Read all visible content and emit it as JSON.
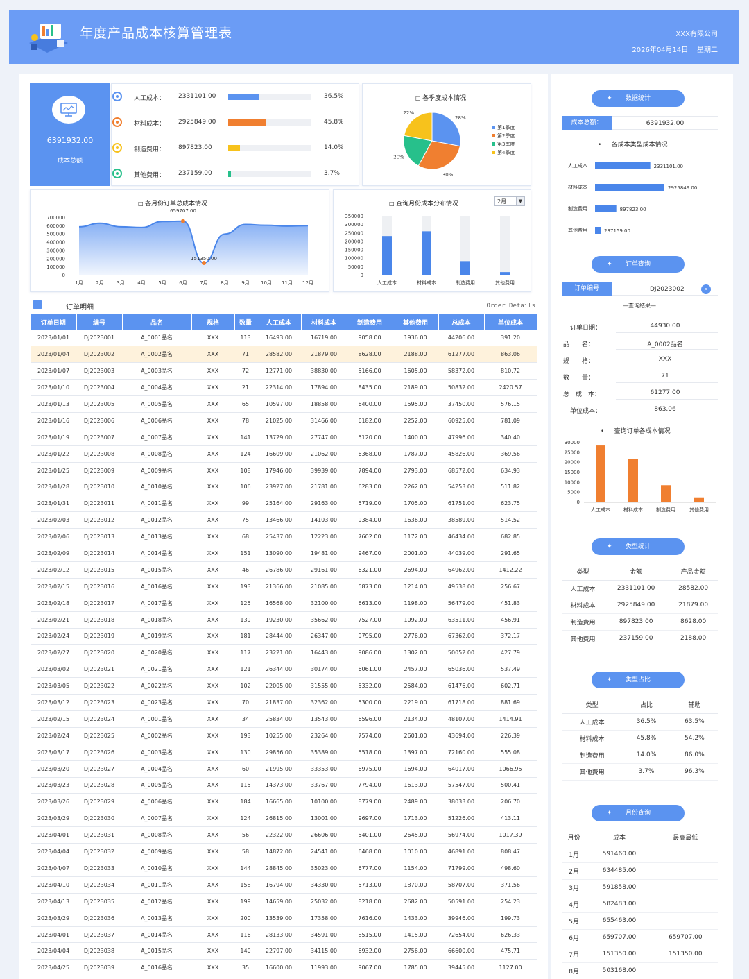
{
  "header": {
    "title": "年度产品成本核算管理表",
    "company": "XXX有限公司",
    "date": "2026年04月14日",
    "weekday": "星期二"
  },
  "summary": {
    "total_value": "6391932.00",
    "total_label": "成本总额",
    "items": [
      {
        "label": "人工成本：",
        "value": "2331101.00",
        "pct": "36.5%",
        "fraction": 0.365,
        "color": "#5b93f0",
        "icon_color": "#5b93f0"
      },
      {
        "label": "材料成本：",
        "value": "2925849.00",
        "pct": "45.8%",
        "fraction": 0.458,
        "color": "#f07f30",
        "icon_color": "#f07f30"
      },
      {
        "label": "制造费用：",
        "value": "897823.00",
        "pct": "14.0%",
        "fraction": 0.14,
        "color": "#f7c21c",
        "icon_color": "#f7c21c"
      },
      {
        "label": "其他费用：",
        "value": "237159.00",
        "pct": "3.7%",
        "fraction": 0.037,
        "color": "#27c08b",
        "icon_color": "#27c08b"
      }
    ]
  },
  "quarter_chart": {
    "title": "各季度成本情况"
  },
  "monthly_chart": {
    "title": "各月份订单总成本情况",
    "max_label": "659707.00",
    "min_label": "151350.00"
  },
  "month_query_chart": {
    "title": "查询月份成本分布情况",
    "selected_month": "2月"
  },
  "orders": {
    "icon": "document-icon",
    "title": "订单明细",
    "subtitle": "Order Details",
    "headers": [
      "订单日期",
      "编号",
      "品名",
      "规格",
      "数量",
      "人工成本",
      "材料成本",
      "制造费用",
      "其他费用",
      "总成本",
      "单位成本"
    ],
    "highlight_row": 1,
    "rows": [
      [
        "2023/01/01",
        "DJ2023001",
        "A_0001品名",
        "XXX",
        "113",
        "16493.00",
        "16719.00",
        "9058.00",
        "1936.00",
        "44206.00",
        "391.20"
      ],
      [
        "2023/01/04",
        "DJ2023002",
        "A_0002品名",
        "XXX",
        "71",
        "28582.00",
        "21879.00",
        "8628.00",
        "2188.00",
        "61277.00",
        "863.06"
      ],
      [
        "2023/01/07",
        "DJ2023003",
        "A_0003品名",
        "XXX",
        "72",
        "12771.00",
        "38830.00",
        "5166.00",
        "1605.00",
        "58372.00",
        "810.72"
      ],
      [
        "2023/01/10",
        "DJ2023004",
        "A_0004品名",
        "XXX",
        "21",
        "22314.00",
        "17894.00",
        "8435.00",
        "2189.00",
        "50832.00",
        "2420.57"
      ],
      [
        "2023/01/13",
        "DJ2023005",
        "A_0005品名",
        "XXX",
        "65",
        "10597.00",
        "18858.00",
        "6400.00",
        "1595.00",
        "37450.00",
        "576.15"
      ],
      [
        "2023/01/16",
        "DJ2023006",
        "A_0006品名",
        "XXX",
        "78",
        "21025.00",
        "31466.00",
        "6182.00",
        "2252.00",
        "60925.00",
        "781.09"
      ],
      [
        "2023/01/19",
        "DJ2023007",
        "A_0007品名",
        "XXX",
        "141",
        "13729.00",
        "27747.00",
        "5120.00",
        "1400.00",
        "47996.00",
        "340.40"
      ],
      [
        "2023/01/22",
        "DJ2023008",
        "A_0008品名",
        "XXX",
        "124",
        "16609.00",
        "21062.00",
        "6368.00",
        "1787.00",
        "45826.00",
        "369.56"
      ],
      [
        "2023/01/25",
        "DJ2023009",
        "A_0009品名",
        "XXX",
        "108",
        "17946.00",
        "39939.00",
        "7894.00",
        "2793.00",
        "68572.00",
        "634.93"
      ],
      [
        "2023/01/28",
        "DJ2023010",
        "A_0010品名",
        "XXX",
        "106",
        "23927.00",
        "21781.00",
        "6283.00",
        "2262.00",
        "54253.00",
        "511.82"
      ],
      [
        "2023/01/31",
        "DJ2023011",
        "A_0011品名",
        "XXX",
        "99",
        "25164.00",
        "29163.00",
        "5719.00",
        "1705.00",
        "61751.00",
        "623.75"
      ],
      [
        "2023/02/03",
        "DJ2023012",
        "A_0012品名",
        "XXX",
        "75",
        "13466.00",
        "14103.00",
        "9384.00",
        "1636.00",
        "38589.00",
        "514.52"
      ],
      [
        "2023/02/06",
        "DJ2023013",
        "A_0013品名",
        "XXX",
        "68",
        "25437.00",
        "12223.00",
        "7602.00",
        "1172.00",
        "46434.00",
        "682.85"
      ],
      [
        "2023/02/09",
        "DJ2023014",
        "A_0014品名",
        "XXX",
        "151",
        "13090.00",
        "19481.00",
        "9467.00",
        "2001.00",
        "44039.00",
        "291.65"
      ],
      [
        "2023/02/12",
        "DJ2023015",
        "A_0015品名",
        "XXX",
        "46",
        "26786.00",
        "29161.00",
        "6321.00",
        "2694.00",
        "64962.00",
        "1412.22"
      ],
      [
        "2023/02/15",
        "DJ2023016",
        "A_0016品名",
        "XXX",
        "193",
        "21366.00",
        "21085.00",
        "5873.00",
        "1214.00",
        "49538.00",
        "256.67"
      ],
      [
        "2023/02/18",
        "DJ2023017",
        "A_0017品名",
        "XXX",
        "125",
        "16568.00",
        "32100.00",
        "6613.00",
        "1198.00",
        "56479.00",
        "451.83"
      ],
      [
        "2023/02/21",
        "DJ2023018",
        "A_0018品名",
        "XXX",
        "139",
        "19230.00",
        "35662.00",
        "7527.00",
        "1092.00",
        "63511.00",
        "456.91"
      ],
      [
        "2023/02/24",
        "DJ2023019",
        "A_0019品名",
        "XXX",
        "181",
        "28444.00",
        "26347.00",
        "9795.00",
        "2776.00",
        "67362.00",
        "372.17"
      ],
      [
        "2023/02/27",
        "DJ2023020",
        "A_0020品名",
        "XXX",
        "117",
        "23221.00",
        "16443.00",
        "9086.00",
        "1302.00",
        "50052.00",
        "427.79"
      ],
      [
        "2023/03/02",
        "DJ2023021",
        "A_0021品名",
        "XXX",
        "121",
        "26344.00",
        "30174.00",
        "6061.00",
        "2457.00",
        "65036.00",
        "537.49"
      ],
      [
        "2023/03/05",
        "DJ2023022",
        "A_0022品名",
        "XXX",
        "102",
        "22005.00",
        "31555.00",
        "5332.00",
        "2584.00",
        "61476.00",
        "602.71"
      ],
      [
        "2023/03/12",
        "DJ2023023",
        "A_0023品名",
        "XXX",
        "70",
        "21837.00",
        "32362.00",
        "5300.00",
        "2219.00",
        "61718.00",
        "881.69"
      ],
      [
        "2023/02/15",
        "DJ2023024",
        "A_0001品名",
        "XXX",
        "34",
        "25834.00",
        "13543.00",
        "6596.00",
        "2134.00",
        "48107.00",
        "1414.91"
      ],
      [
        "2023/02/24",
        "DJ2023025",
        "A_0002品名",
        "XXX",
        "193",
        "10255.00",
        "23264.00",
        "7574.00",
        "2601.00",
        "43694.00",
        "226.39"
      ],
      [
        "2023/03/17",
        "DJ2023026",
        "A_0003品名",
        "XXX",
        "130",
        "29856.00",
        "35389.00",
        "5518.00",
        "1397.00",
        "72160.00",
        "555.08"
      ],
      [
        "2023/03/20",
        "DJ2023027",
        "A_0004品名",
        "XXX",
        "60",
        "21995.00",
        "33353.00",
        "6975.00",
        "1694.00",
        "64017.00",
        "1066.95"
      ],
      [
        "2023/03/23",
        "DJ2023028",
        "A_0005品名",
        "XXX",
        "115",
        "14373.00",
        "33767.00",
        "7794.00",
        "1613.00",
        "57547.00",
        "500.41"
      ],
      [
        "2023/03/26",
        "DJ2023029",
        "A_0006品名",
        "XXX",
        "184",
        "16665.00",
        "10100.00",
        "8779.00",
        "2489.00",
        "38033.00",
        "206.70"
      ],
      [
        "2023/03/29",
        "DJ2023030",
        "A_0007品名",
        "XXX",
        "124",
        "26815.00",
        "13001.00",
        "9697.00",
        "1713.00",
        "51226.00",
        "413.11"
      ],
      [
        "2023/04/01",
        "DJ2023031",
        "A_0008品名",
        "XXX",
        "56",
        "22322.00",
        "26606.00",
        "5401.00",
        "2645.00",
        "56974.00",
        "1017.39"
      ],
      [
        "2023/04/04",
        "DJ2023032",
        "A_0009品名",
        "XXX",
        "58",
        "14872.00",
        "24541.00",
        "6468.00",
        "1010.00",
        "46891.00",
        "808.47"
      ],
      [
        "2023/04/07",
        "DJ2023033",
        "A_0010品名",
        "XXX",
        "144",
        "28845.00",
        "35023.00",
        "6777.00",
        "1154.00",
        "71799.00",
        "498.60"
      ],
      [
        "2023/04/10",
        "DJ2023034",
        "A_0011品名",
        "XXX",
        "158",
        "16794.00",
        "34330.00",
        "5713.00",
        "1870.00",
        "58707.00",
        "371.56"
      ],
      [
        "2023/04/13",
        "DJ2023035",
        "A_0012品名",
        "XXX",
        "199",
        "14659.00",
        "25032.00",
        "8218.00",
        "2682.00",
        "50591.00",
        "254.23"
      ],
      [
        "2023/03/29",
        "DJ2023036",
        "A_0013品名",
        "XXX",
        "200",
        "13539.00",
        "17358.00",
        "7616.00",
        "1433.00",
        "39946.00",
        "199.73"
      ],
      [
        "2023/04/01",
        "DJ2023037",
        "A_0014品名",
        "XXX",
        "116",
        "28133.00",
        "34591.00",
        "8515.00",
        "1415.00",
        "72654.00",
        "626.33"
      ],
      [
        "2023/04/04",
        "DJ2023038",
        "A_0015品名",
        "XXX",
        "140",
        "22797.00",
        "34115.00",
        "6932.00",
        "2756.00",
        "66600.00",
        "475.71"
      ],
      [
        "2023/04/25",
        "DJ2023039",
        "A_0016品名",
        "XXX",
        "35",
        "16600.00",
        "11993.00",
        "9067.00",
        "1785.00",
        "39445.00",
        "1127.00"
      ]
    ]
  },
  "side": {
    "stats_btn": "数据统计",
    "total_label": "成本总额：",
    "total_value": "6391932.00",
    "type_chart_title": "各成本类型成本情况",
    "order_btn": "订单查询",
    "order_no_label": "订单编号",
    "order_no_value": "DJ2023002",
    "result_label": "—查询结果—",
    "details": [
      {
        "label": "订单日期：",
        "value": "44930.00"
      },
      {
        "label": "品　　名：",
        "value": "A_0002品名"
      },
      {
        "label": "规　　格：",
        "value": "XXX"
      },
      {
        "label": "数　　量：",
        "value": "71"
      },
      {
        "label": "总　成　本：",
        "value": "61277.00"
      },
      {
        "label": "单位成本：",
        "value": "863.06"
      }
    ],
    "order_chart_title": "查询订单各成本情况",
    "type_stats_btn": "类型统计",
    "type_stats_headers": [
      "类型",
      "金额",
      "产品金额"
    ],
    "type_stats_rows": [
      [
        "人工成本",
        "2331101.00",
        "28582.00"
      ],
      [
        "材料成本",
        "2925849.00",
        "21879.00"
      ],
      [
        "制造费用",
        "897823.00",
        "8628.00"
      ],
      [
        "其他费用",
        "237159.00",
        "2188.00"
      ]
    ],
    "ratio_btn": "类型占比",
    "ratio_headers": [
      "类型",
      "占比",
      "辅助"
    ],
    "ratio_rows": [
      [
        "人工成本",
        "36.5%",
        "63.5%"
      ],
      [
        "材料成本",
        "45.8%",
        "54.2%"
      ],
      [
        "制造费用",
        "14.0%",
        "86.0%"
      ],
      [
        "其他费用",
        "3.7%",
        "96.3%"
      ]
    ],
    "month_btn": "月份查询",
    "month_headers": [
      "月份",
      "成本",
      "最高最低"
    ],
    "month_rows": [
      [
        "1月",
        "591460.00",
        ""
      ],
      [
        "2月",
        "634485.00",
        ""
      ],
      [
        "3月",
        "591858.00",
        ""
      ],
      [
        "4月",
        "582483.00",
        ""
      ],
      [
        "5月",
        "655463.00",
        ""
      ],
      [
        "6月",
        "659707.00",
        "659707.00"
      ],
      [
        "7月",
        "151350.00",
        "151350.00"
      ],
      [
        "8月",
        "503168.00",
        ""
      ]
    ]
  },
  "chart_data": [
    {
      "type": "pie",
      "title": "各季度成本情况",
      "categories": [
        "第1季度",
        "第2季度",
        "第3季度",
        "第4季度"
      ],
      "values": [
        28,
        30,
        20,
        22
      ],
      "value_labels": [
        "28%",
        "30%",
        "20%",
        "22%"
      ],
      "colors": [
        "#5b93f0",
        "#f07f30",
        "#27c08b",
        "#f7c21c"
      ],
      "legend": "right"
    },
    {
      "type": "area",
      "title": "各月份订单总成本情况",
      "categories": [
        "1月",
        "2月",
        "3月",
        "4月",
        "5月",
        "6月",
        "7月",
        "8月",
        "9月",
        "10月",
        "11月",
        "12月"
      ],
      "values": [
        591460,
        634485,
        591858,
        582483,
        655463,
        659707,
        151350,
        503168,
        620000,
        610000,
        600000,
        605000
      ],
      "ylim": [
        0,
        700000
      ],
      "yticks": [
        "700000",
        "600000",
        "500000",
        "400000",
        "300000",
        "200000",
        "100000",
        "0"
      ],
      "annotations": [
        "659707.00",
        "151350.00"
      ]
    },
    {
      "type": "bar",
      "title": "查询月份成本分布情况",
      "categories": [
        "人工成本",
        "材料成本",
        "制造费用",
        "其他费用"
      ],
      "values": [
        234000,
        262000,
        85000,
        20000
      ],
      "background_values": [
        350000,
        350000,
        350000,
        350000
      ],
      "ylim": [
        0,
        350000
      ],
      "yticks": [
        "350000",
        "300000",
        "250000",
        "200000",
        "150000",
        "100000",
        "50000",
        "0"
      ]
    },
    {
      "type": "bar",
      "title": "各成本类型成本情况",
      "orientation": "horizontal",
      "categories": [
        "人工成本",
        "材料成本",
        "制造费用",
        "其他费用"
      ],
      "values": [
        2331101,
        2925849,
        897823,
        237159
      ],
      "value_labels": [
        "2331101.00",
        "2925849.00",
        "897823.00",
        "237159.00"
      ]
    },
    {
      "type": "bar",
      "title": "查询订单各成本情况",
      "categories": [
        "人工成本",
        "材料成本",
        "制造费用",
        "其他费用"
      ],
      "values": [
        28582,
        21879,
        8628,
        2188
      ],
      "ylim": [
        0,
        30000
      ],
      "yticks": [
        "30000",
        "25000",
        "20000",
        "15000",
        "10000",
        "5000",
        "0"
      ]
    }
  ]
}
